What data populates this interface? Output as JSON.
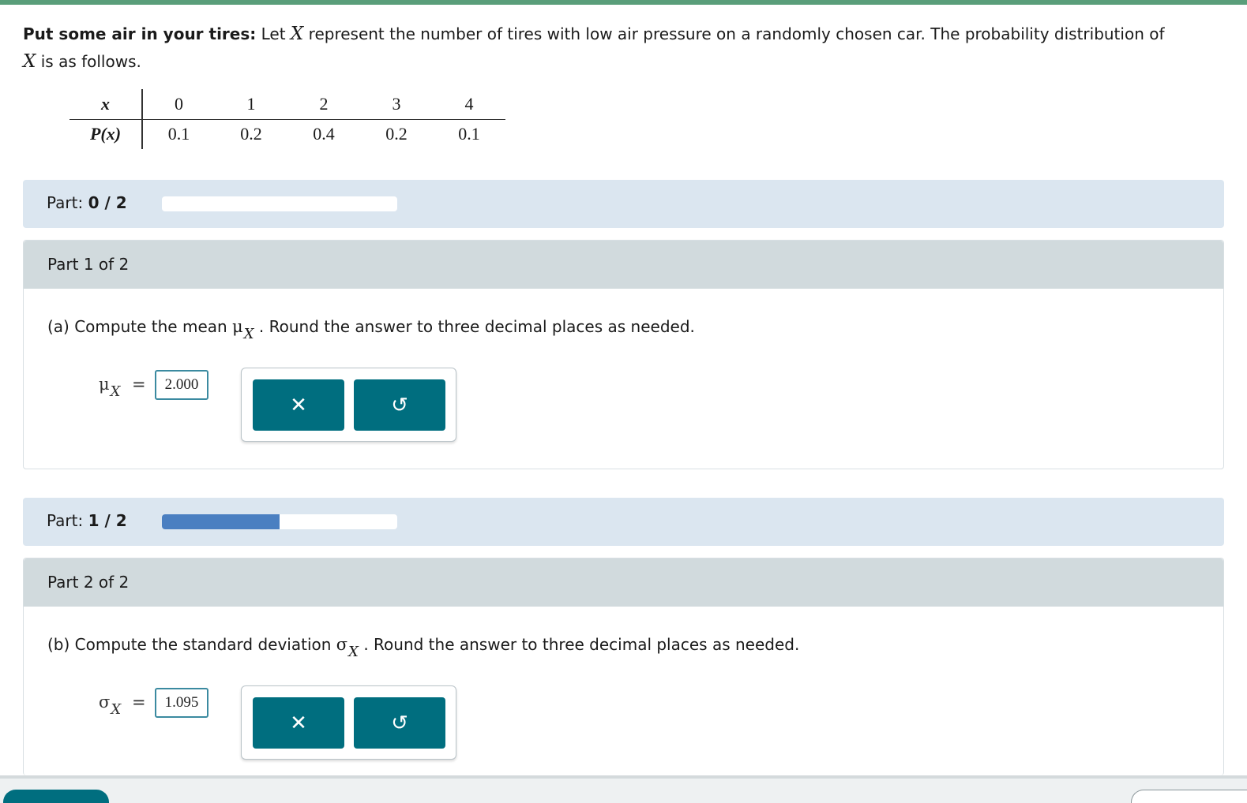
{
  "problem": {
    "title": "Put some air in your tires:",
    "text_1": "Let",
    "var": "X",
    "text_2": "represent the number of tires with low air pressure on a randomly chosen car. The probability distribution of",
    "text_3": "is as follows."
  },
  "distribution": {
    "x_label": "x",
    "p_label": "P(x)",
    "x": [
      "0",
      "1",
      "2",
      "3",
      "4"
    ],
    "p": [
      "0.1",
      "0.2",
      "0.4",
      "0.2",
      "0.1"
    ]
  },
  "parts": [
    {
      "progress_label": "Part:",
      "progress_value": "0 / 2",
      "progress_fraction": 0,
      "header": "Part 1 of 2",
      "question_prefix": "(a) Compute the mean",
      "symbol": "μ",
      "subscript": "X",
      "question_suffix": ". Round the answer to three decimal places as needed.",
      "answer": "2.000"
    },
    {
      "progress_label": "Part:",
      "progress_value": "1 / 2",
      "progress_fraction": 0.5,
      "header": "Part 2 of 2",
      "question_prefix": "(b) Compute the standard deviation",
      "symbol": "σ",
      "subscript": "X",
      "question_suffix": ". Round the answer to three decimal places as needed.",
      "answer": "1.095"
    }
  ],
  "buttons": {
    "clear_icon": "close-icon",
    "clear_glyph": "✕",
    "undo_icon": "undo-icon",
    "undo_glyph": "↺"
  },
  "colors": {
    "accent": "#006e7f",
    "progress": "#4a7fc1",
    "part_bar": "#dbe6f0",
    "card_header": "#d1dadd"
  }
}
